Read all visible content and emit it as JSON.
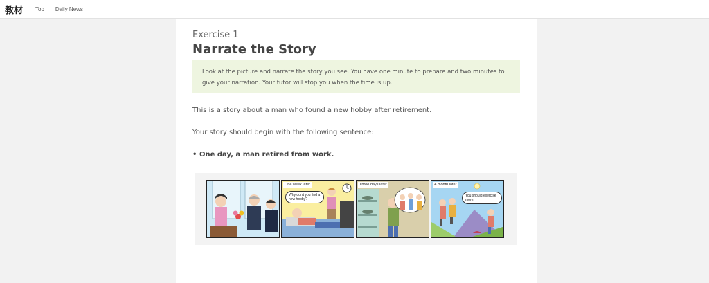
{
  "header": {
    "brand": "教材",
    "nav": [
      "Top",
      "Daily News"
    ]
  },
  "exercise": {
    "number_label": "Exercise 1",
    "title": "Narrate the Story",
    "instructions": "Look at the picture and narrate the story you see. You have one minute to prepare and two minutes to give your narration. Your tutor will stop you when the time is up.",
    "intro": "This is a story about a man who found a new hobby after retirement.",
    "begin_prompt": "Your story should begin with the following sentence:",
    "first_sentence": "One day, a man retired from work."
  },
  "comic": {
    "panels": [
      {
        "caption": ""
      },
      {
        "caption": "One week later",
        "bubble": "Why don't you find a new hobby?"
      },
      {
        "caption": "Three days later"
      },
      {
        "caption": "A month later",
        "bubble": "You should exercise more."
      }
    ]
  }
}
